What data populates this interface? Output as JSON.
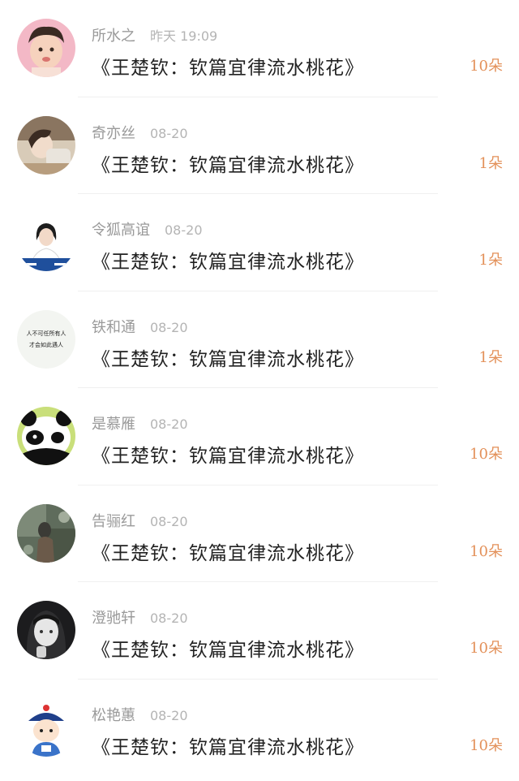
{
  "items": [
    {
      "user": "所水之",
      "time": "昨天 19:09",
      "title": "《王楚钦：钦篇宜律流水桃花》",
      "count": "10朵",
      "avatar": "baby-photo-avatar"
    },
    {
      "user": "奇亦丝",
      "time": "08-20",
      "title": "《王楚钦：钦篇宜律流水桃花》",
      "count": "1朵",
      "avatar": "girl-photo-avatar"
    },
    {
      "user": "令狐高谊",
      "time": "08-20",
      "title": "《王楚钦：钦篇宜律流水桃花》",
      "count": "1朵",
      "avatar": "portrait-photo-avatar"
    },
    {
      "user": "铁和通",
      "time": "08-20",
      "title": "《王楚钦：钦篇宜律流水桃花》",
      "count": "1朵",
      "avatar": "calligraphy-avatar"
    },
    {
      "user": "是慕雁",
      "time": "08-20",
      "title": "《王楚钦：钦篇宜律流水桃花》",
      "count": "10朵",
      "avatar": "panda-avatar"
    },
    {
      "user": "告骊红",
      "time": "08-20",
      "title": "《王楚钦：钦篇宜律流水桃花》",
      "count": "10朵",
      "avatar": "scenery-photo-avatar"
    },
    {
      "user": "澄驰轩",
      "time": "08-20",
      "title": "《王楚钦：钦篇宜律流水桃花》",
      "count": "10朵",
      "avatar": "anime-girl-avatar"
    },
    {
      "user": "松艳蕙",
      "time": "08-20",
      "title": "《王楚钦：钦篇宜律流水桃花》",
      "count": "10朵",
      "avatar": "cartoon-official-avatar"
    }
  ],
  "avatar_text": {
    "calligraphy_line1": "人不可任所有人",
    "calligraphy_line2": "才会如此遇人"
  }
}
